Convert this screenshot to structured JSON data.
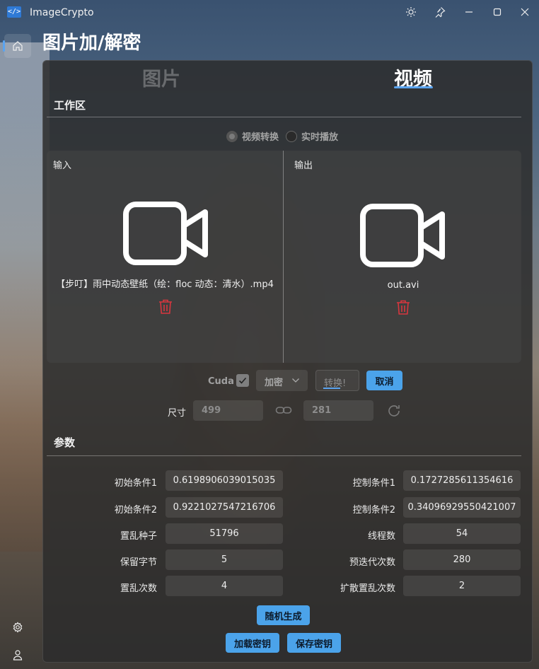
{
  "window": {
    "app_title": "ImageCrypto",
    "logo_text": "</>"
  },
  "page": {
    "title": "图片加/解密"
  },
  "tabs": [
    {
      "label": "图片",
      "selected": false
    },
    {
      "label": "视频",
      "selected": true
    }
  ],
  "workspace": {
    "title": "工作区",
    "modes": [
      {
        "label": "视频转换",
        "selected": true
      },
      {
        "label": "实时播放",
        "selected": false
      }
    ],
    "input_label": "输入",
    "output_label": "输出",
    "input_file": "【步叮】雨中动态壁纸（绘：floc 动态：清水）.mp4",
    "output_file": "out.avi",
    "cuda_label": "Cuda",
    "cuda_checked": true,
    "mode_select": "加密",
    "convert_label": "转换!",
    "cancel_label": "取消",
    "size_label": "尺寸",
    "width": "499",
    "height": "281"
  },
  "params": {
    "title": "参数",
    "left": [
      {
        "label": "初始条件1",
        "value": "0.6198906039015035"
      },
      {
        "label": "初始条件2",
        "value": "0.9221027547216706"
      },
      {
        "label": "置乱种子",
        "value": "51796"
      },
      {
        "label": "保留字节",
        "value": "5"
      },
      {
        "label": "置乱次数",
        "value": "4"
      }
    ],
    "right": [
      {
        "label": "控制条件1",
        "value": "0.1727285611354616"
      },
      {
        "label": "控制条件2",
        "value": "0.34096929550421007"
      },
      {
        "label": "线程数",
        "value": "54"
      },
      {
        "label": "预迭代次数",
        "value": "280"
      },
      {
        "label": "扩散置乱次数",
        "value": "2"
      }
    ],
    "random_label": "随机生成",
    "load_key_label": "加载密钥",
    "save_key_label": "保存密钥"
  },
  "colors": {
    "accent": "#4ba3ea",
    "trash": "#d9363e"
  }
}
